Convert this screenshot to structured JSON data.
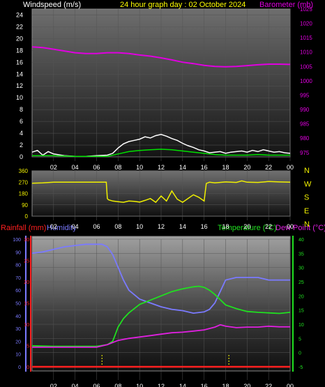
{
  "header": {
    "windspeed_label": "Windspeed (m/s)",
    "title": "24 hour graph day : 02 October 2024",
    "barometer_label": "Barometer (mb)"
  },
  "lower_header": {
    "rainfall_label": "Rainfall (mm)",
    "humidity_label": "Humidity",
    "temperature_label": "Temperature (°C)",
    "dewpoint_label": "Dew Point (°C)"
  },
  "colors": {
    "windspeed": "#ffffff",
    "gust": "#c8c8c8",
    "avg_wind": "#00e000",
    "barometer": "#e000e0",
    "direction": "#f0f000",
    "rainfall": "#ff2020",
    "humidity": "#7a7aff",
    "temperature": "#20e020",
    "dewpoint": "#e020e0",
    "header_title": "#ffff00"
  },
  "chart_data": [
    {
      "type": "line",
      "name": "wind-baro",
      "x_ticks": [
        "02",
        "04",
        "06",
        "08",
        "10",
        "12",
        "14",
        "16",
        "18",
        "20",
        "22",
        "00"
      ],
      "xlim": [
        0,
        24
      ],
      "y_left": {
        "label": "Windspeed (m/s)",
        "ticks": [
          "0",
          "2",
          "4",
          "6",
          "8",
          "10",
          "12",
          "14",
          "16",
          "18",
          "20",
          "22",
          "24"
        ],
        "ylim": [
          0,
          25
        ]
      },
      "y_right": {
        "label": "Barometer (mb)",
        "ticks": [
          "975",
          "980",
          "985",
          "990",
          "995",
          "1000",
          "1005",
          "1010",
          "1015",
          "1020",
          "1025"
        ],
        "ylim": [
          973.5,
          1025
        ]
      },
      "series": [
        {
          "name": "Windspeed (m/s)",
          "axis": "left",
          "color": "#ffffff",
          "x": [
            0,
            0.5,
            1,
            1.5,
            2,
            3,
            4,
            5,
            6,
            7,
            7.5,
            8,
            8.5,
            9,
            9.5,
            10,
            10.5,
            11,
            11.5,
            12,
            12.5,
            13,
            13.5,
            14,
            14.5,
            15,
            15.5,
            16,
            16.5,
            17,
            17.5,
            18,
            18.5,
            19,
            19.5,
            20,
            20.5,
            21,
            21.5,
            22,
            22.5,
            23,
            23.5,
            24
          ],
          "y": [
            0.8,
            1.1,
            0.3,
            0.9,
            0.5,
            0.2,
            0.1,
            0.1,
            0.2,
            0.3,
            0.6,
            1.5,
            2.2,
            2.6,
            2.8,
            3.0,
            3.4,
            3.2,
            3.6,
            3.8,
            3.5,
            3.1,
            2.8,
            2.3,
            1.9,
            1.6,
            1.2,
            1.0,
            0.7,
            0.8,
            0.9,
            0.6,
            0.8,
            0.9,
            1.0,
            0.8,
            1.1,
            0.9,
            1.2,
            1.0,
            0.8,
            0.9,
            0.7,
            0.6
          ]
        },
        {
          "name": "Average windspeed",
          "axis": "left",
          "color": "#00e000",
          "x": [
            0,
            2,
            4,
            6,
            7,
            8,
            9,
            10,
            11,
            12,
            13,
            14,
            15,
            16,
            17,
            18,
            19,
            20,
            21,
            22,
            23,
            24
          ],
          "y": [
            0.2,
            0.2,
            0.1,
            0.1,
            0.1,
            0.5,
            0.9,
            1.1,
            1.2,
            1.3,
            1.2,
            1.0,
            0.8,
            0.6,
            0.4,
            0.3,
            0.3,
            0.3,
            0.4,
            0.3,
            0.3,
            0.3
          ]
        },
        {
          "name": "Barometer (mb)",
          "axis": "right",
          "color": "#e000e0",
          "x": [
            0,
            1,
            2,
            3,
            4,
            5,
            6,
            7,
            8,
            9,
            10,
            11,
            12,
            13,
            14,
            15,
            16,
            17,
            18,
            19,
            20,
            21,
            22,
            23,
            24
          ],
          "y": [
            1011.8,
            1011.6,
            1011.0,
            1010.4,
            1009.8,
            1009.5,
            1009.5,
            1009.8,
            1009.8,
            1009.5,
            1009.0,
            1008.6,
            1008.0,
            1007.3,
            1006.5,
            1006.0,
            1005.4,
            1005.0,
            1004.9,
            1005.0,
            1005.3,
            1005.6,
            1005.8,
            1005.8,
            1005.7
          ]
        }
      ]
    },
    {
      "type": "line",
      "name": "wind-direction",
      "x_ticks": [
        "02",
        "04",
        "06",
        "08",
        "10",
        "12",
        "14",
        "16",
        "18",
        "20",
        "22",
        "00"
      ],
      "xlim": [
        0,
        24
      ],
      "y_left": {
        "ticks": [
          "0",
          "90",
          "180",
          "270",
          "360"
        ],
        "ylim": [
          0,
          360
        ]
      },
      "y_right": {
        "ticks": [
          "N",
          "W",
          "S",
          "E",
          "N"
        ]
      },
      "series": [
        {
          "name": "Wind direction",
          "color": "#f0f000",
          "x": [
            0,
            1,
            2,
            3,
            4,
            5,
            6,
            6.9,
            7,
            7.1,
            7.5,
            8,
            8.5,
            9,
            9.5,
            10,
            10.5,
            11,
            11.5,
            12,
            12.5,
            13,
            13.5,
            14,
            14.5,
            15,
            15.5,
            16,
            16.2,
            16.5,
            17,
            18,
            19,
            19.5,
            20,
            21,
            22,
            23,
            24
          ],
          "y": [
            262,
            264,
            270,
            270,
            270,
            270,
            270,
            270,
            140,
            130,
            120,
            115,
            110,
            120,
            118,
            112,
            125,
            140,
            110,
            160,
            120,
            200,
            135,
            110,
            140,
            170,
            150,
            120,
            260,
            270,
            265,
            272,
            268,
            280,
            270,
            268,
            275,
            272,
            270
          ]
        }
      ]
    },
    {
      "type": "line",
      "name": "temp-humidity-rain",
      "x_ticks": [
        "02",
        "04",
        "06",
        "08",
        "10",
        "12",
        "14",
        "16",
        "18",
        "20",
        "22",
        "00"
      ],
      "xlim": [
        0,
        24
      ],
      "y_left_outer": {
        "label": "Humidity",
        "ticks": [
          "0",
          "10",
          "20",
          "30",
          "40",
          "50",
          "60",
          "70",
          "80",
          "90",
          "100"
        ],
        "ylim": [
          0,
          100
        ]
      },
      "y_left_inner": {
        "label": "Rainfall (mm)",
        "ticks": [
          "0",
          "5",
          "10",
          "15",
          "20",
          "25",
          "30"
        ],
        "ylim": [
          0,
          30
        ]
      },
      "y_right": {
        "label": "Temperature (°C)",
        "ticks": [
          "-5",
          "0",
          "5",
          "10",
          "15",
          "20",
          "25",
          "30",
          "35",
          "40"
        ],
        "ylim": [
          -5,
          40
        ]
      },
      "series": [
        {
          "name": "Humidity",
          "axis": "left_outer",
          "color": "#7a7aff",
          "x": [
            0,
            1,
            2,
            3,
            4,
            5,
            6,
            6.5,
            7,
            7.5,
            8,
            8.5,
            9,
            10,
            11,
            12,
            13,
            14,
            15,
            16,
            16.5,
            17,
            18,
            19,
            20,
            21,
            22,
            23,
            24
          ],
          "y": [
            89,
            90,
            92,
            94,
            95,
            96,
            96,
            96,
            94,
            88,
            78,
            68,
            60,
            53,
            50,
            47,
            45,
            44,
            42,
            43,
            45,
            50,
            68,
            70,
            70,
            70,
            68,
            68,
            68
          ]
        },
        {
          "name": "Temperature (°C)",
          "axis": "right",
          "color": "#20e020",
          "x": [
            0,
            1,
            2,
            3,
            4,
            5,
            6,
            7,
            7.5,
            8,
            8.5,
            9,
            10,
            11,
            12,
            13,
            14,
            15,
            15.5,
            16,
            16.5,
            17,
            18,
            19,
            20,
            21,
            22,
            23,
            24
          ],
          "y": [
            2.4,
            2.3,
            2.2,
            2.2,
            2.2,
            2.2,
            2.2,
            2.8,
            4.0,
            9.0,
            12.0,
            14.0,
            17.0,
            18.5,
            20.0,
            21.5,
            22.5,
            23.2,
            23.4,
            23.0,
            22.0,
            20.5,
            16.8,
            15.5,
            14.5,
            14.2,
            14.0,
            13.8,
            14.2
          ]
        },
        {
          "name": "Dew Point (°C)",
          "axis": "right",
          "color": "#e020e0",
          "x": [
            0,
            1,
            2,
            3,
            4,
            5,
            6,
            7,
            8,
            9,
            10,
            11,
            12,
            13,
            14,
            15,
            16,
            17,
            17.5,
            18,
            19,
            20,
            21,
            22,
            23,
            24
          ],
          "y": [
            1.9,
            1.9,
            1.9,
            1.9,
            1.9,
            1.9,
            1.9,
            2.8,
            4.3,
            5.0,
            5.5,
            6.0,
            6.5,
            7.0,
            7.2,
            7.6,
            8.0,
            9.0,
            9.8,
            9.3,
            8.8,
            9.0,
            9.0,
            9.3,
            9.1,
            9.1
          ]
        },
        {
          "name": "Rainfall (mm)",
          "axis": "left_inner",
          "color": "#ff2020",
          "x": [
            0,
            24
          ],
          "y": [
            0,
            0
          ]
        }
      ],
      "rain_markers_x": [
        6.5,
        18.3
      ]
    }
  ]
}
